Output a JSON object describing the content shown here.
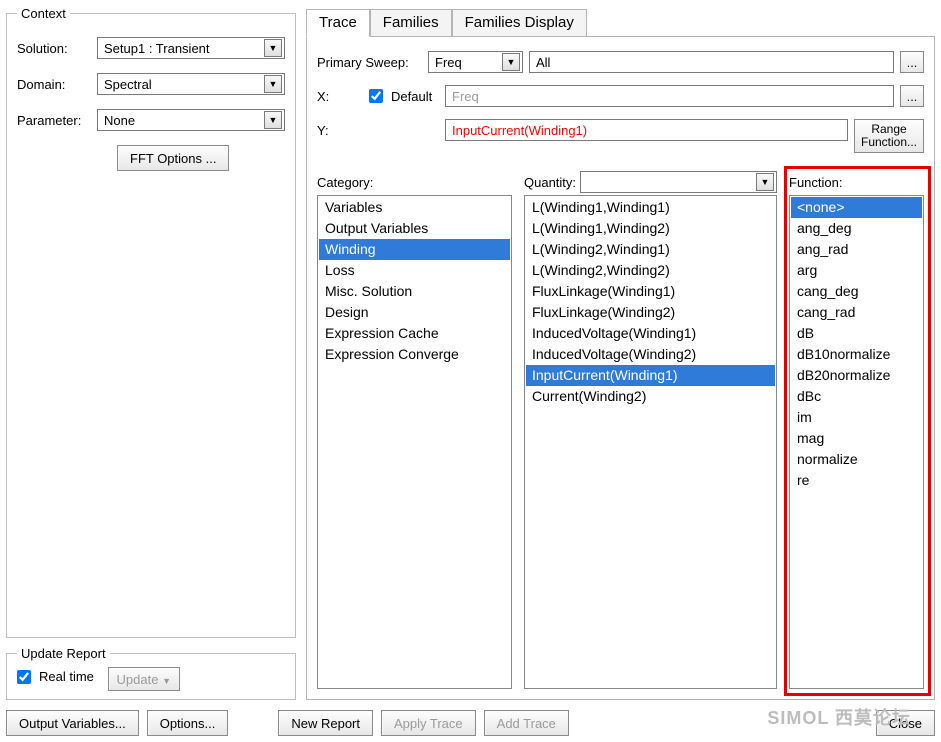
{
  "context": {
    "legend": "Context",
    "solution_label": "Solution:",
    "solution_value": "Setup1 : Transient",
    "domain_label": "Domain:",
    "domain_value": "Spectral",
    "parameter_label": "Parameter:",
    "parameter_value": "None",
    "fft_btn": "FFT Options ..."
  },
  "update_report": {
    "legend": "Update Report",
    "realtime_label": "Real time",
    "realtime_checked": true,
    "update_btn": "Update"
  },
  "tabs": {
    "trace": "Trace",
    "families": "Families",
    "families_display": "Families Display"
  },
  "trace": {
    "primary_sweep_label": "Primary Sweep:",
    "primary_sweep_value": "Freq",
    "primary_sweep_range": "All",
    "x_label": "X:",
    "x_default_label": "Default",
    "x_default_checked": true,
    "x_value": "Freq",
    "y_label": "Y:",
    "y_value": "InputCurrent(Winding1)",
    "range_fn_btn": "Range\nFunction...",
    "category_label": "Category:",
    "quantity_label": "Quantity:",
    "function_label": "Function:",
    "ellipsis": "..."
  },
  "categories": {
    "items": [
      "Variables",
      "Output Variables",
      "Winding",
      "Loss",
      "Misc. Solution",
      "Design",
      "Expression Cache",
      "Expression Converge"
    ],
    "selected": 2
  },
  "quantities": {
    "items": [
      "L(Winding1,Winding1)",
      "L(Winding1,Winding2)",
      "L(Winding2,Winding1)",
      "L(Winding2,Winding2)",
      "FluxLinkage(Winding1)",
      "FluxLinkage(Winding2)",
      "InducedVoltage(Winding1)",
      "InducedVoltage(Winding2)",
      "InputCurrent(Winding1)",
      "Current(Winding2)"
    ],
    "selected": 8
  },
  "functions": {
    "items": [
      "<none>",
      "ang_deg",
      "ang_rad",
      "arg",
      "cang_deg",
      "cang_rad",
      "dB",
      "dB10normalize",
      "dB20normalize",
      "dBc",
      "im",
      "mag",
      "normalize",
      "re"
    ],
    "selected": 0
  },
  "bottom": {
    "output_variables": "Output Variables...",
    "options": "Options...",
    "new_report": "New Report",
    "apply_trace": "Apply Trace",
    "add_trace": "Add Trace",
    "close": "Close"
  },
  "watermark": "SIMOL 西莫论坛"
}
